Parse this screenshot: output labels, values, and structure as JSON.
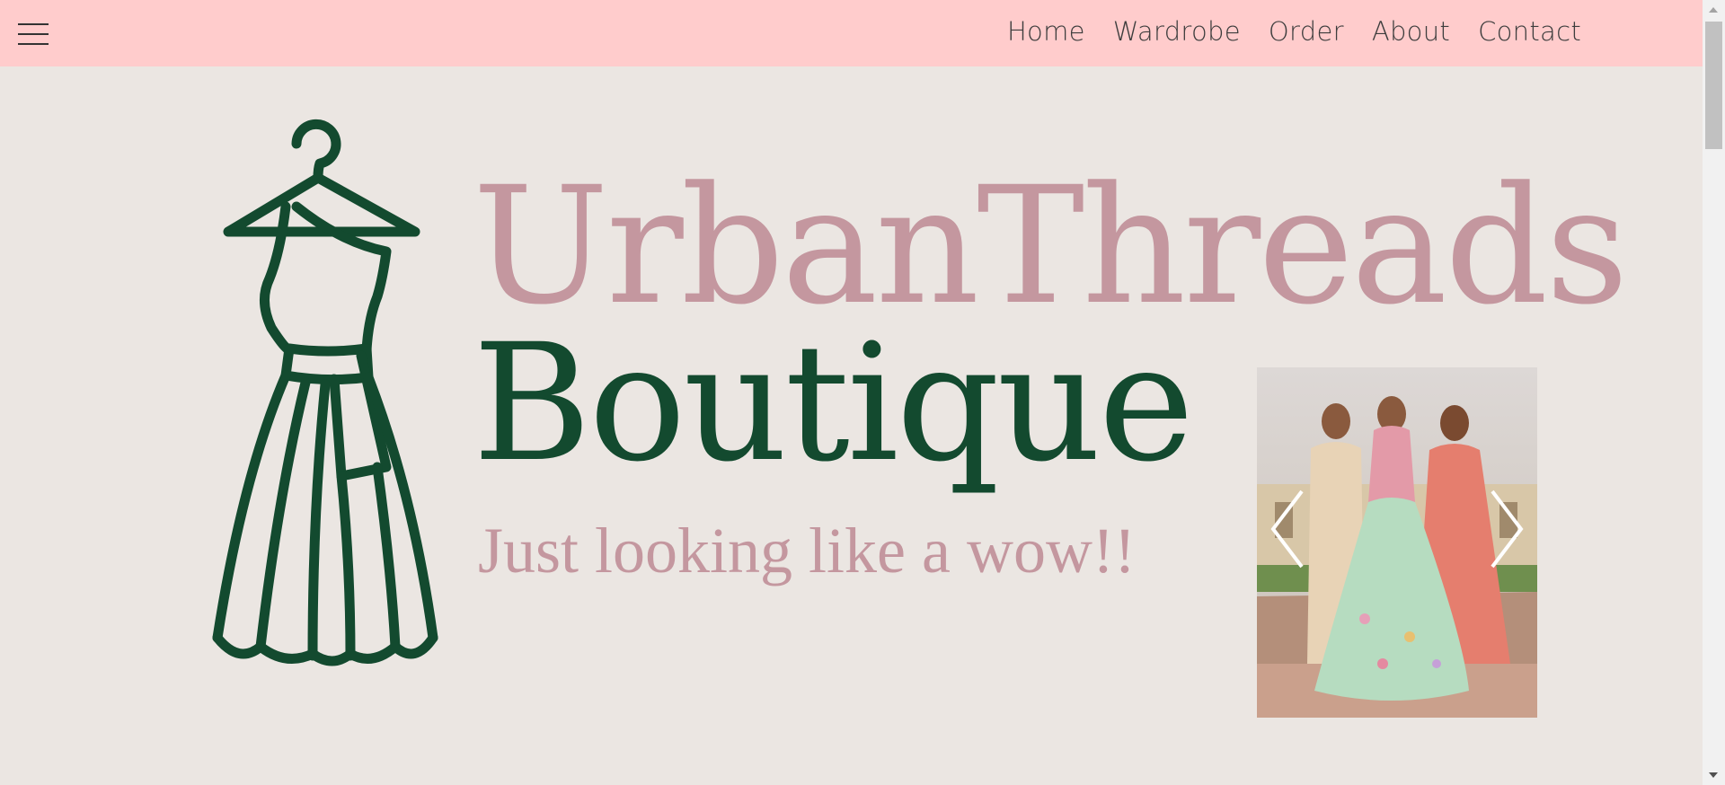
{
  "nav": {
    "menu_icon": "hamburger-menu-icon",
    "links": [
      "Home",
      "Wardrobe",
      "Order",
      "About",
      "Contact"
    ]
  },
  "hero": {
    "brand_line1": "UrbanThreads",
    "brand_line2": "Boutique",
    "tagline": "Just looking like a wow!!",
    "logo_icon": "dress-on-hanger-icon"
  },
  "carousel": {
    "image_description_icon": "lehenga-photo",
    "prev_icon": "chevron-left-icon",
    "next_icon": "chevron-right-icon"
  },
  "colors": {
    "navbar_bg": "#ffcccc",
    "page_bg": "#ebe6e2",
    "brand_pink": "#c4979f",
    "brand_green": "#134a2f"
  }
}
